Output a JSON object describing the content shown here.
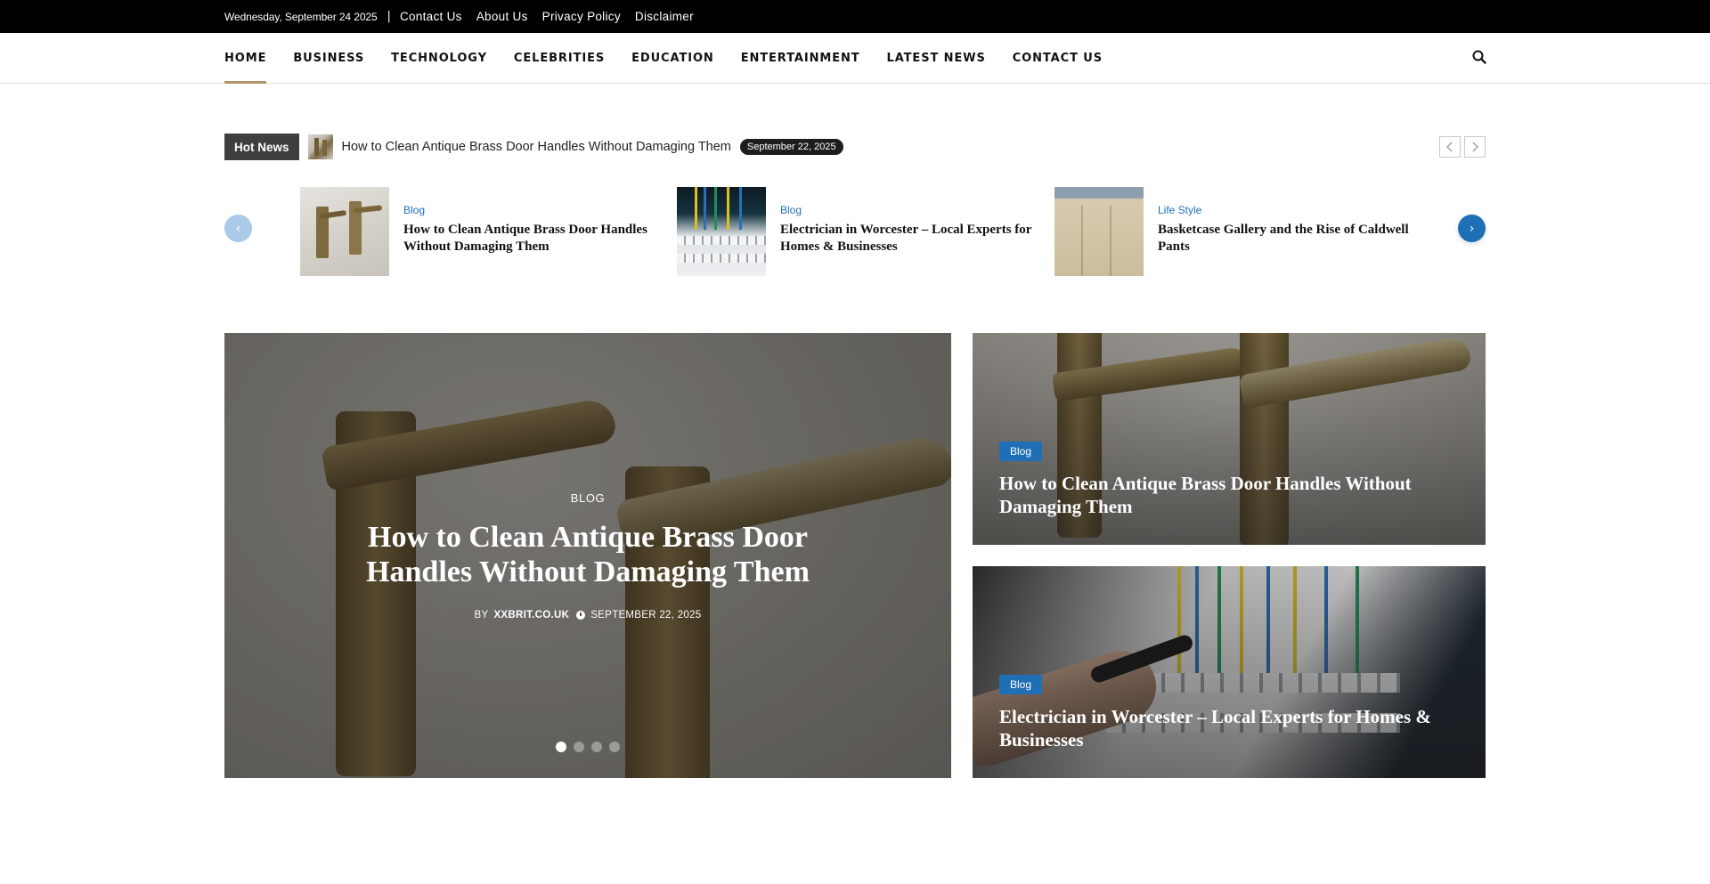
{
  "topbar": {
    "date": "Wednesday, September 24 2025",
    "separator": "|",
    "links": [
      "Contact Us",
      "About Us",
      "Privacy Policy",
      "Disclaimer"
    ]
  },
  "nav": {
    "items": [
      "HOME",
      "BUSINESS",
      "TECHNOLOGY",
      "CELEBRITIES",
      "EDUCATION",
      "ENTERTAINMENT",
      "LATEST NEWS",
      "CONTACT US"
    ],
    "active": "HOME",
    "search_icon": "search-icon"
  },
  "hot_news": {
    "label": "Hot News",
    "title": "How to Clean Antique Brass Door Handles Without Damaging Them",
    "date": "September 22, 2025",
    "prev_icon": "chevron-left-icon",
    "next_icon": "chevron-right-icon"
  },
  "strip": {
    "cards": [
      {
        "category": "Blog",
        "title": "How to Clean Antique Brass Door Handles Without Damaging Them"
      },
      {
        "category": "Blog",
        "title": "Electrician in Worcester – Local Experts for Homes & Businesses"
      },
      {
        "category": "Life Style",
        "title": "Basketcase Gallery and the Rise of Caldwell Pants"
      }
    ],
    "prev_glyph": "‹",
    "next_glyph": "›"
  },
  "hero": {
    "category": "BLOG",
    "title": "How to Clean Antique Brass Door Handles Without Damaging Them",
    "by": "BY",
    "author": "XXBRIT.CO.UK",
    "date": "SEPTEMBER 22, 2025",
    "slides": 4,
    "active_slide": 1
  },
  "side": {
    "cards": [
      {
        "category": "Blog",
        "title": "How to Clean Antique Brass Door Handles Without Damaging Them"
      },
      {
        "category": "Blog",
        "title": "Electrician in Worcester – Local Experts for Homes & Businesses"
      }
    ]
  },
  "colors": {
    "accent": "#1f6fb6",
    "nav_underline": "#b3956b",
    "topbar_bg": "#000000"
  }
}
